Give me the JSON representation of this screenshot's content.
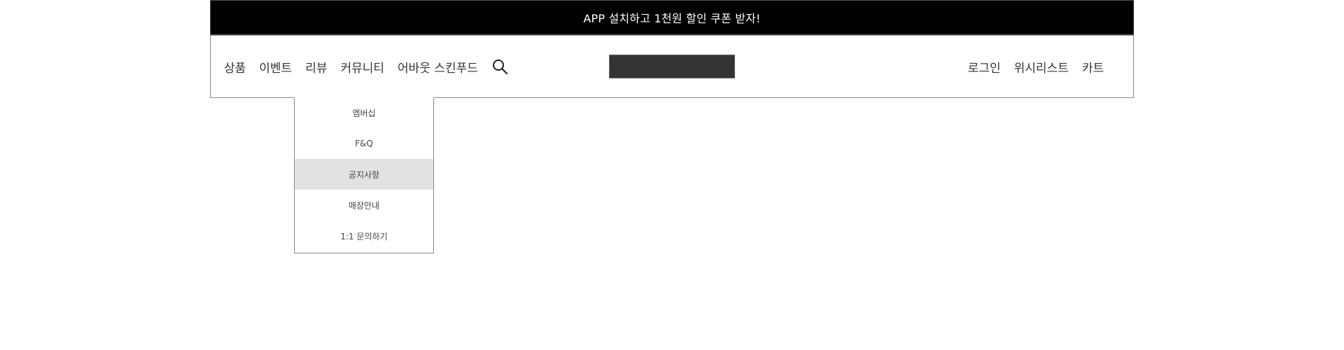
{
  "promo": {
    "text": "APP 설치하고 1천원 할인 쿠폰 받자!"
  },
  "nav": {
    "left": [
      {
        "label": "상품"
      },
      {
        "label": "이벤트"
      },
      {
        "label": "리뷰"
      },
      {
        "label": "커뮤니티"
      },
      {
        "label": "어바웃 스킨푸드"
      }
    ],
    "search_icon": "search-icon",
    "right": [
      {
        "label": "로그인"
      },
      {
        "label": "위시리스트"
      },
      {
        "label": "카트"
      }
    ]
  },
  "logo": {
    "color": "#333333"
  },
  "dropdown": {
    "items": [
      {
        "label": "멤버십"
      },
      {
        "label": "F&Q"
      },
      {
        "label": "공지사항",
        "active": true
      },
      {
        "label": "매장안내"
      },
      {
        "label": "1:1 문의하기"
      }
    ],
    "active_color": "#e2e2e2"
  },
  "colors": {
    "promo_bg": "#000000",
    "promo_text": "#ffffff",
    "text": "#333333"
  }
}
